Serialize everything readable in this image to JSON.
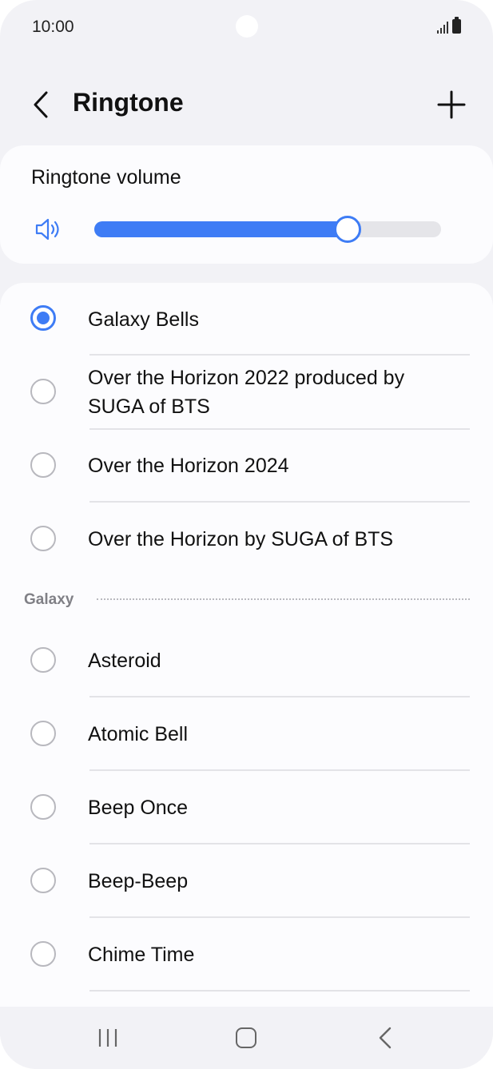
{
  "status_bar": {
    "time": "10:00"
  },
  "header": {
    "title": "Ringtone"
  },
  "volume": {
    "label": "Ringtone volume",
    "level_fraction": 0.73,
    "accent_color": "#3e7cf5"
  },
  "ringtones_top": [
    {
      "label": "Galaxy Bells",
      "selected": true
    },
    {
      "label": "Over the Horizon 2022 produced by SUGA of BTS",
      "selected": false
    },
    {
      "label": "Over the Horizon 2024",
      "selected": false
    },
    {
      "label": "Over the Horizon by SUGA of BTS",
      "selected": false
    }
  ],
  "section": {
    "label": "Galaxy"
  },
  "ringtones_galaxy": [
    {
      "label": "Asteroid",
      "selected": false
    },
    {
      "label": "Atomic Bell",
      "selected": false
    },
    {
      "label": "Beep Once",
      "selected": false
    },
    {
      "label": "Beep-Beep",
      "selected": false
    },
    {
      "label": "Chime Time",
      "selected": false
    }
  ],
  "icons": {
    "back": "chevron-left-icon",
    "add": "plus-icon",
    "speaker": "speaker-volume-icon",
    "nav_recents": "recents-icon",
    "nav_home": "home-icon",
    "nav_back": "nav-back-icon"
  }
}
